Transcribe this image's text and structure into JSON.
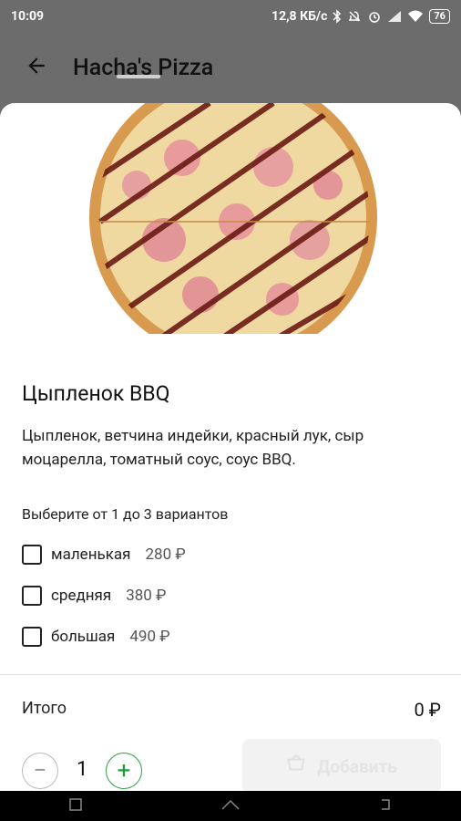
{
  "status_bar": {
    "time": "10:09",
    "network_speed": "12,8 КБ/с",
    "battery": "76",
    "icons": [
      "bluetooth-icon",
      "do-not-disturb-icon",
      "alarm-icon",
      "signal-icon",
      "wifi-icon",
      "battery-icon"
    ]
  },
  "app_bar": {
    "back_icon": "arrow-back-icon",
    "title": "Hacha's Pizza"
  },
  "product": {
    "image": "pizza-bbq-image",
    "title": "Цыпленок BBQ",
    "description": "Цыпленок, ветчина индейки, красный лук, сыр моцарелла, томатный соус, соус BBQ.",
    "choose_hint": "Выберите от 1 до 3 вариантов",
    "options": [
      {
        "label": "маленькая",
        "price": "280 ₽"
      },
      {
        "label": "средняя",
        "price": "380 ₽"
      },
      {
        "label": "большая",
        "price": "490 ₽"
      }
    ]
  },
  "footer": {
    "total_label": "Итого",
    "total_value": "0 ₽",
    "quantity": "1",
    "minus": "−",
    "plus": "+",
    "add_label": "Добавить",
    "add_icon": "cart-icon"
  },
  "nav_bar": {
    "icons": [
      "recent-apps-icon",
      "home-icon",
      "back-icon"
    ]
  }
}
